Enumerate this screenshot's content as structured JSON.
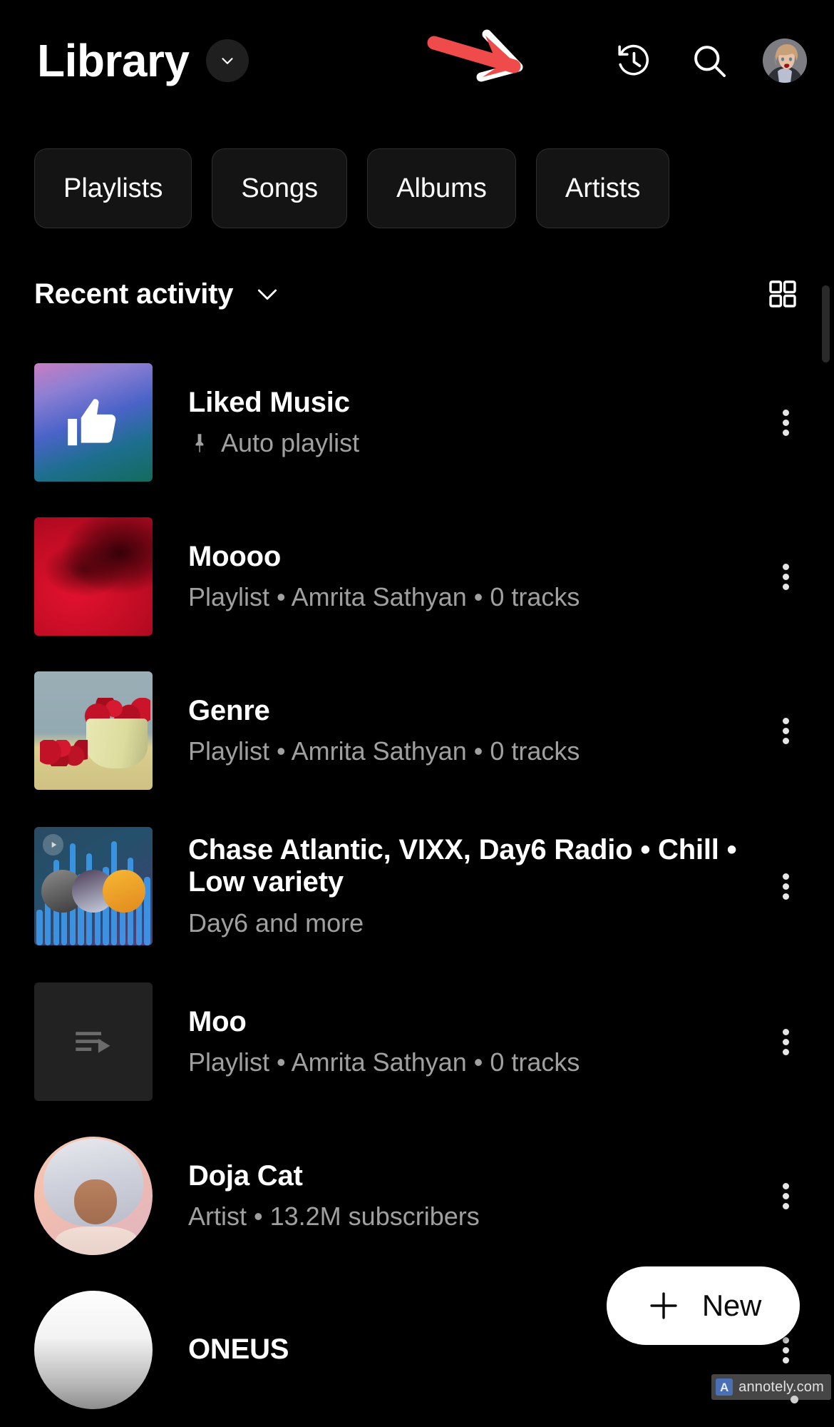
{
  "header": {
    "title": "Library",
    "title_chevron_icon": "chevron-down-icon",
    "history_icon": "history-clock-icon",
    "search_icon": "search-icon",
    "avatar_icon": "account-avatar",
    "annotation_icon": "red-arrow-annotation"
  },
  "chips": [
    {
      "label": "Playlists"
    },
    {
      "label": "Songs"
    },
    {
      "label": "Albums"
    },
    {
      "label": "Artists"
    }
  ],
  "section": {
    "title": "Recent activity",
    "chevron_icon": "chevron-down-icon",
    "grid_toggle_icon": "grid-view-icon"
  },
  "list": [
    {
      "title": "Liked Music",
      "subtitle": "Auto playlist",
      "pin_icon": "pin-icon",
      "thumb": "liked-music-thumbnail",
      "menu_icon": "more-vertical-icon"
    },
    {
      "title": "Moooo",
      "subtitle": "Playlist • Amrita Sathyan • 0 tracks",
      "thumb": "playlist-cover-red-leaves",
      "menu_icon": "more-vertical-icon"
    },
    {
      "title": "Genre",
      "subtitle": "Playlist • Amrita Sathyan • 0 tracks",
      "thumb": "playlist-cover-cherries",
      "menu_icon": "more-vertical-icon"
    },
    {
      "title": "Chase Atlantic, VIXX, Day6 Radio • Chill • Low variety",
      "subtitle": "Day6 and more",
      "thumb": "radio-mix-thumbnail",
      "menu_icon": "more-vertical-icon"
    },
    {
      "title": "Moo",
      "subtitle": "Playlist • Amrita Sathyan • 0 tracks",
      "thumb": "empty-playlist-placeholder",
      "menu_icon": "more-vertical-icon"
    },
    {
      "title": "Doja Cat",
      "subtitle": "Artist • 13.2M subscribers",
      "thumb": "artist-avatar-doja-cat",
      "menu_icon": "more-vertical-icon"
    },
    {
      "title": "ONEUS",
      "subtitle": "",
      "thumb": "artist-avatar-oneus",
      "menu_icon": "more-vertical-icon"
    }
  ],
  "fab": {
    "label": "New",
    "icon": "plus-icon"
  },
  "watermark": {
    "logo": "A",
    "text": "annotely.com"
  },
  "colors": {
    "background": "#000000",
    "chip_bg": "#141414",
    "chip_border": "#2e2e2e",
    "secondary_text": "#a0a0a0",
    "annotation_red": "#ef4b4b",
    "fab_bg": "#ffffff"
  }
}
